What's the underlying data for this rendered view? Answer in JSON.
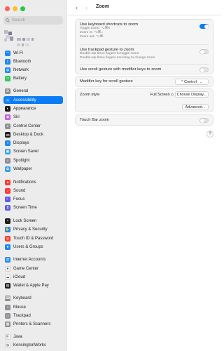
{
  "window": {
    "title": "Zoom"
  },
  "search": {
    "placeholder": "Search"
  },
  "sidebar": {
    "items": [
      {
        "label": "Wi-Fi",
        "color": "#1e88f2",
        "icon": "wifi-icon"
      },
      {
        "label": "Bluetooth",
        "color": "#1e88f2",
        "icon": "bluetooth-icon"
      },
      {
        "label": "Network",
        "color": "#1e88f2",
        "icon": "globe-icon"
      },
      {
        "label": "Battery",
        "color": "#34c759",
        "icon": "battery-icon"
      },
      {
        "label": "General",
        "color": "#8e8e93",
        "icon": "gear-icon"
      },
      {
        "label": "Accessibility",
        "color": "#1e88f2",
        "icon": "accessibility-icon",
        "active": true
      },
      {
        "label": "Appearance",
        "color": "#1d1d1f",
        "icon": "appearance-icon"
      },
      {
        "label": "Siri",
        "color": "#c25ee0",
        "icon": "siri-icon"
      },
      {
        "label": "Control Center",
        "color": "#8e8e93",
        "icon": "control-center-icon"
      },
      {
        "label": "Desktop & Dock",
        "color": "#1d1d1f",
        "icon": "dock-icon"
      },
      {
        "label": "Displays",
        "color": "#1e88f2",
        "icon": "display-icon"
      },
      {
        "label": "Screen Saver",
        "color": "#3aa0e8",
        "icon": "screen-saver-icon"
      },
      {
        "label": "Spotlight",
        "color": "#8e8e93",
        "icon": "spotlight-icon"
      },
      {
        "label": "Wallpaper",
        "color": "#3aa0e8",
        "icon": "wallpaper-icon"
      },
      {
        "label": "Notifications",
        "color": "#ff3b30",
        "icon": "notifications-icon"
      },
      {
        "label": "Sound",
        "color": "#ff3b30",
        "icon": "sound-icon"
      },
      {
        "label": "Focus",
        "color": "#5e5ce6",
        "icon": "focus-icon"
      },
      {
        "label": "Screen Time",
        "color": "#5e5ce6",
        "icon": "screen-time-icon"
      },
      {
        "label": "Lock Screen",
        "color": "#1d1d1f",
        "icon": "lock-icon"
      },
      {
        "label": "Privacy & Security",
        "color": "#1e88f2",
        "icon": "privacy-icon"
      },
      {
        "label": "Touch ID & Password",
        "color": "#ff3b30",
        "icon": "fingerprint-icon"
      },
      {
        "label": "Users & Groups",
        "color": "#1e88f2",
        "icon": "users-icon"
      },
      {
        "label": "Internet Accounts",
        "color": "#1e88f2",
        "icon": "at-icon"
      },
      {
        "label": "Game Center",
        "color": "#f2f2f2",
        "icon": "game-center-icon"
      },
      {
        "label": "iCloud",
        "color": "#ffffff",
        "icon": "icloud-icon"
      },
      {
        "label": "Wallet & Apple Pay",
        "color": "#1d1d1f",
        "icon": "wallet-icon"
      },
      {
        "label": "Keyboard",
        "color": "#8e8e93",
        "icon": "keyboard-icon"
      },
      {
        "label": "Mouse",
        "color": "#8e8e93",
        "icon": "mouse-icon"
      },
      {
        "label": "Trackpad",
        "color": "#8e8e93",
        "icon": "trackpad-icon"
      },
      {
        "label": "Printers & Scanners",
        "color": "#8e8e93",
        "icon": "printer-icon"
      },
      {
        "label": "Java",
        "color": "#ffffff",
        "icon": "java-icon"
      },
      {
        "label": "KensingtonWorks",
        "color": "#ffffff",
        "icon": "kensington-icon"
      }
    ]
  },
  "zoom": {
    "keyboard_shortcuts": {
      "label": "Use keyboard shortcuts to zoom",
      "lines": [
        "Toggle zoom: ⌥⌘8",
        "Zoom in: ⌥⌘=",
        "Zoom out: ⌥⌘-"
      ],
      "on": true
    },
    "trackpad_gesture": {
      "label": "Use trackpad gesture to zoom",
      "lines": [
        "Double-tap three fingers to toggle zoom",
        "Double-tap three fingers and drag to change zoom"
      ],
      "on": false
    },
    "scroll_gesture": {
      "label": "Use scroll gesture with modifier keys to zoom",
      "on": false
    },
    "modifier_key": {
      "label": "Modifier key for scroll gesture",
      "value": "^ Control"
    },
    "zoom_style": {
      "label": "Zoom style",
      "value": "Full Screen ◇",
      "choose_display": "Choose Display...",
      "advanced": "Advanced..."
    },
    "touch_bar_zoom": {
      "label": "Touch Bar zoom",
      "on": false
    },
    "help": "?"
  },
  "colors": {
    "accent": "#0a7cf6"
  }
}
